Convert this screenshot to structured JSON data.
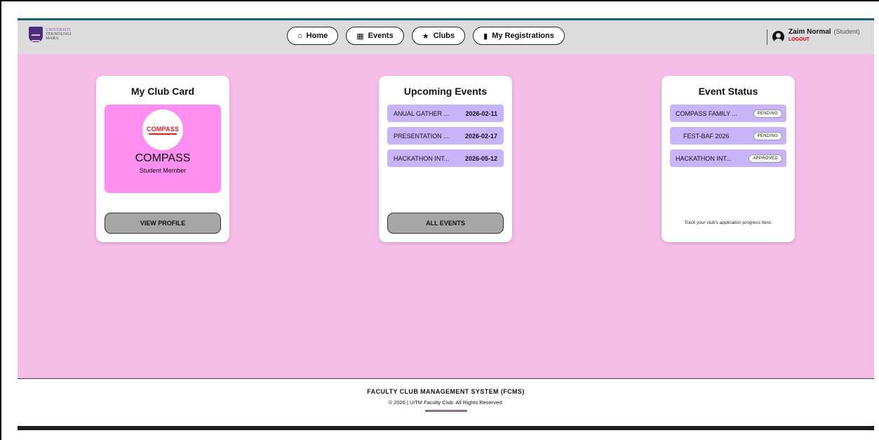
{
  "header": {
    "logo": {
      "line1": "UNIVERSITI",
      "line2": "TEKNOLOGI",
      "line3": "MARA"
    },
    "nav": [
      {
        "label": "Home",
        "icon": "home-icon"
      },
      {
        "label": "Events",
        "icon": "calendar-icon"
      },
      {
        "label": "Clubs",
        "icon": "star-icon"
      },
      {
        "label": "My Registrations",
        "icon": "bookmark-icon"
      }
    ],
    "user": {
      "name": "Zaim Normal",
      "role": "(Student)",
      "logout": "LOGOUT"
    }
  },
  "club_card": {
    "title": "My Club Card",
    "logo_text": "COMPASS",
    "club_name": "COMPASS",
    "member_role": "Student Member",
    "button": "VIEW PROFILE"
  },
  "upcoming_events": {
    "title": "Upcoming Events",
    "items": [
      {
        "name": "ANUAL GATHER ...",
        "date": "2026-02-11"
      },
      {
        "name": "PRESENTATION ...",
        "date": "2026-02-17"
      },
      {
        "name": "HACKATHON INT...",
        "date": "2026-05-12"
      }
    ],
    "button": "ALL EVENTS"
  },
  "event_status": {
    "title": "Event Status",
    "items": [
      {
        "name": "COMPASS FAMILY ...",
        "status": "PENDING"
      },
      {
        "name": "FEST-BAF 2026",
        "status": "PENDING"
      },
      {
        "name": "HACKATHON INT...",
        "status": "APPROVED"
      }
    ],
    "note": "Track your club's application progress here."
  },
  "footer": {
    "title": "FACULTY CLUB MANAGEMENT SYSTEM (FCMS)",
    "copyright": "© 2026 | UiTM Faculty Club. All Rights Reserved."
  },
  "colors": {
    "header_bg": "#dcdcdc",
    "header_accent": "#17636f",
    "main_bg": "#f6bde9",
    "club_panel": "#fe8ff0",
    "list_row": "#c8b4fb",
    "button_gray": "#a6a6a6",
    "logout_red": "#d8001a"
  }
}
